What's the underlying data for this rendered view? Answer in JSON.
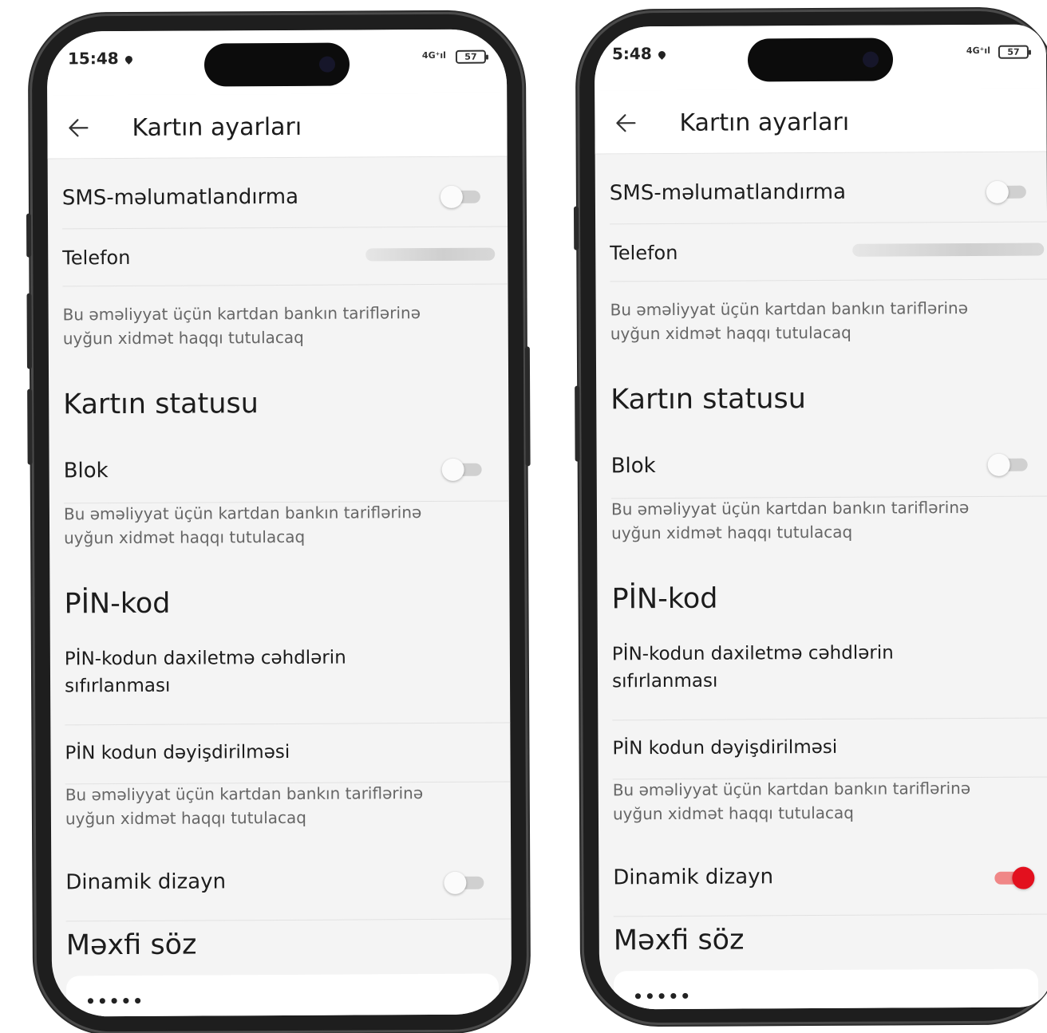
{
  "statusbar": {
    "time": "15:48",
    "time_2": "5:48",
    "signal": "4G⁺ıl",
    "battery": "57"
  },
  "appbar": {
    "title": "Kartın ayarları"
  },
  "sms": {
    "label": "SMS-məlumatlandırma"
  },
  "telefon": {
    "label": "Telefon"
  },
  "note": {
    "text": "Bu əməliyyat üçün kartdan bankın tariflərinə uyğun xidmət haqqı tutulacaq"
  },
  "card_status": {
    "title": "Kartın statusu",
    "blok_label": "Blok"
  },
  "pin": {
    "title": "PİN-kod",
    "reset_line1": "PİN-kodun daxiletmə cəhdlərin",
    "reset_line2": "sıfırlanması",
    "change_label": "PİN kodun dəyişdirilməsi"
  },
  "dynamic": {
    "label": "Dinamik dizayn"
  },
  "secret": {
    "title": "Məxfi söz",
    "value": "•••••"
  },
  "toggle_states": {
    "phone1_dynamic_design": false,
    "phone2_dynamic_design": true
  },
  "colors": {
    "accent_red": "#e3101e",
    "background": "#f4f4f4"
  }
}
